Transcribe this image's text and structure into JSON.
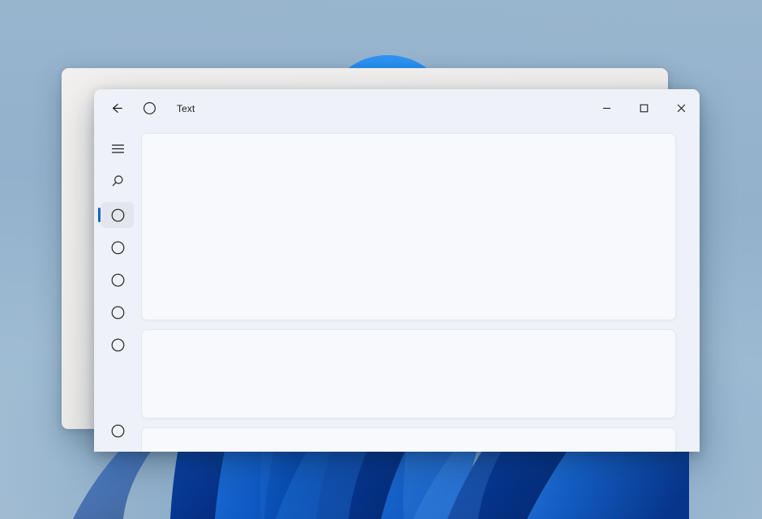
{
  "desktop": {
    "wallpaper_name": "windows-bloom-wallpaper",
    "sky_color": "#9ab6cf",
    "bloom_color": "#0b5fd0"
  },
  "background_window": {
    "name": "inactive-background-window",
    "surface_color": "#f1efed"
  },
  "app_window": {
    "surface_color": "#eef1f8",
    "titlebar": {
      "back_label": "←",
      "app_icon_name": "circle-icon",
      "title": "Text",
      "controls": {
        "minimize_label": "─",
        "maximize_label": "□",
        "close_label": "✕"
      }
    },
    "navrail": {
      "menu_icon": "hamburger-menu-icon",
      "search_icon": "search-icon",
      "accent_color": "#0a64c8",
      "selected_index": 0,
      "items": [
        {
          "icon": "circle-icon",
          "selected": true
        },
        {
          "icon": "circle-icon",
          "selected": false
        },
        {
          "icon": "circle-icon",
          "selected": false
        },
        {
          "icon": "circle-icon",
          "selected": false
        },
        {
          "icon": "circle-icon",
          "selected": false
        }
      ],
      "bottom_item": {
        "icon": "circle-icon",
        "selected": false
      }
    },
    "content": {
      "card_surface_color": "#f7f9fc",
      "cards": [
        {
          "name": "content-card-1",
          "text": ""
        },
        {
          "name": "content-card-2",
          "text": ""
        },
        {
          "name": "content-card-3",
          "text": ""
        }
      ]
    }
  }
}
